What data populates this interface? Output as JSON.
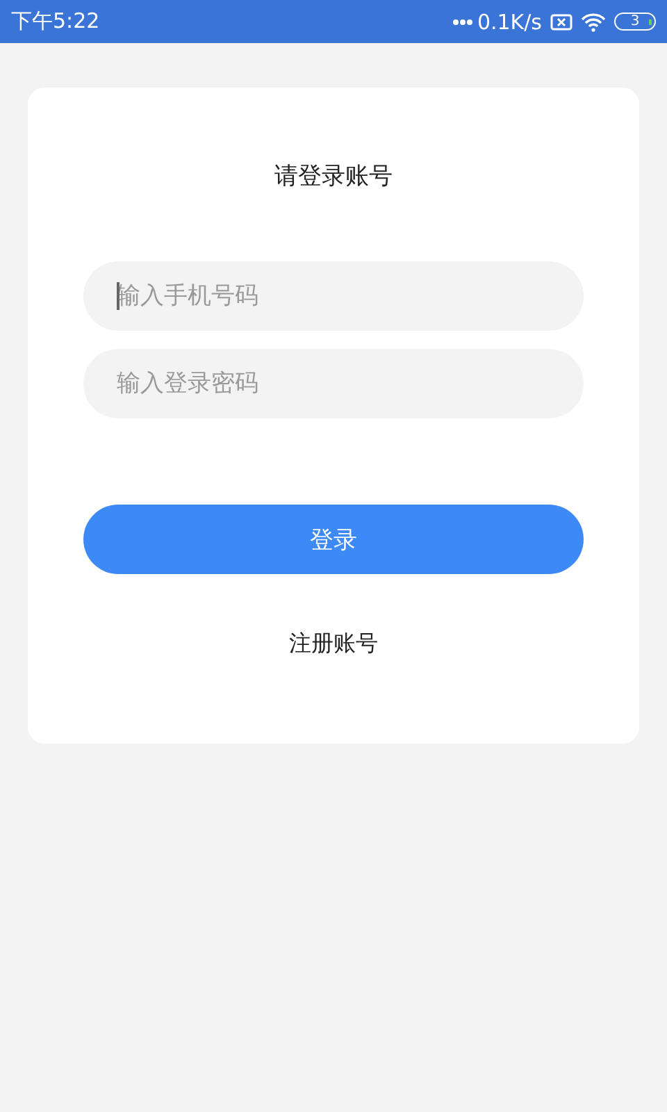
{
  "status_bar": {
    "time": "下午5:22",
    "net_speed": "0.1K/s",
    "battery": "3"
  },
  "title": "请登录账号",
  "fields": [
    {
      "placeholder": "输入手机号码",
      "focused": true
    },
    {
      "placeholder": "输入登录密码",
      "focused": false
    }
  ],
  "login_button": "登录",
  "register_link": "注册账号"
}
